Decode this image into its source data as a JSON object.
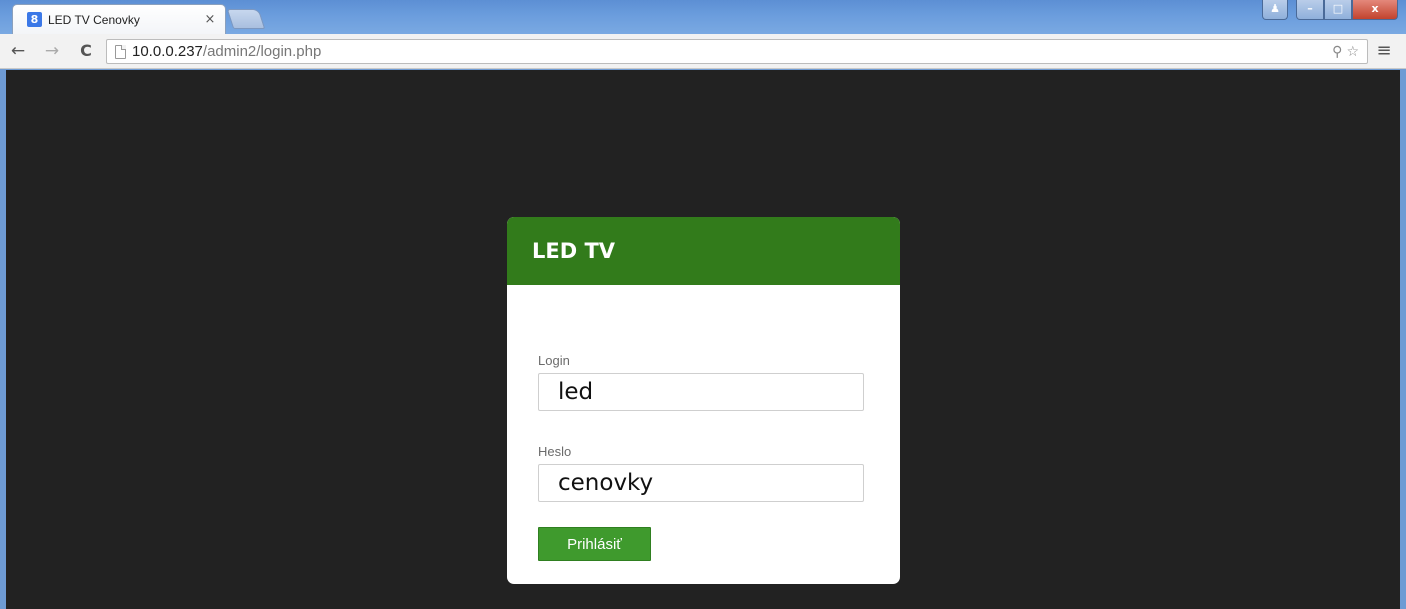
{
  "browser": {
    "tab_title": "LED TV Cenovky",
    "tab_favicon": "8",
    "tab_close": "×",
    "url_host": "10.0.0.237",
    "url_path": "/admin2/login.php",
    "nav_back": "←",
    "nav_forward": "→",
    "nav_reload": "C",
    "zoom_icon": "⚲",
    "bookmark_icon": "☆",
    "menu_icon": "≡",
    "win_user": "♟",
    "win_minimize": "–",
    "win_restore": "□",
    "win_close": "x"
  },
  "login": {
    "header_title": "LED TV",
    "login_label": "Login",
    "login_value": "led",
    "password_label": "Heslo",
    "password_value": "cenovky",
    "submit_label": "Prihlásiť"
  },
  "colors": {
    "header_green": "#327b1b",
    "button_green": "#3f9a2d",
    "page_background": "#222222"
  }
}
